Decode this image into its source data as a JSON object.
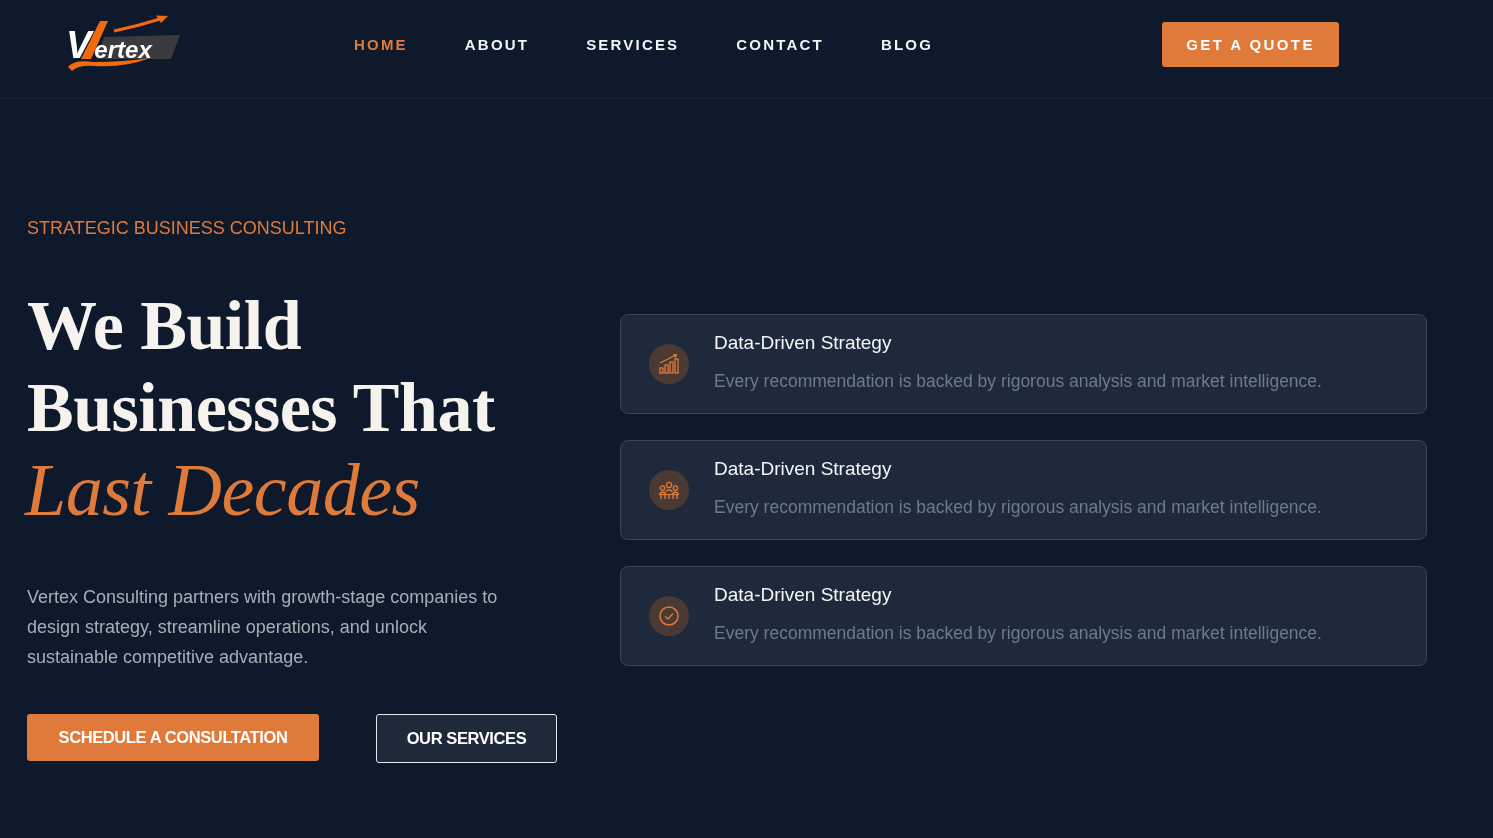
{
  "header": {
    "logo": "Vertex",
    "nav": [
      {
        "label": "HOME",
        "selected": true
      },
      {
        "label": "ABOUT",
        "selected": false
      },
      {
        "label": "SERVICES",
        "selected": false
      },
      {
        "label": "CONTACT",
        "selected": false
      },
      {
        "label": "BLOG",
        "selected": false
      }
    ],
    "cta": "GET A QUOTE"
  },
  "hero": {
    "eyebrow": "STRATEGIC BUSINESS CONSULTING",
    "heading_lines": [
      "We Build",
      "Businesses That"
    ],
    "heading_accent": "Last Decades",
    "description": "Vertex Consulting partners with growth-stage companies to design strategy, streamline operations, and unlock sustainable competitive advantage.",
    "buttons": [
      {
        "label": "SCHEDULE A CONSULTATION",
        "kind": "primary"
      },
      {
        "label": "OUR SERVICES",
        "kind": "outline"
      }
    ]
  },
  "features": [
    {
      "title": "Data-Driven Strategy",
      "description": "Every recommendation is backed by rigorous analysis and market intelligence."
    },
    {
      "title": "Data-Driven Strategy",
      "description": "Every recommendation is backed by rigorous analysis and market intelligence."
    },
    {
      "title": "Data-Driven Strategy",
      "description": "Every recommendation is backed by rigorous analysis and market intelligence."
    }
  ]
}
